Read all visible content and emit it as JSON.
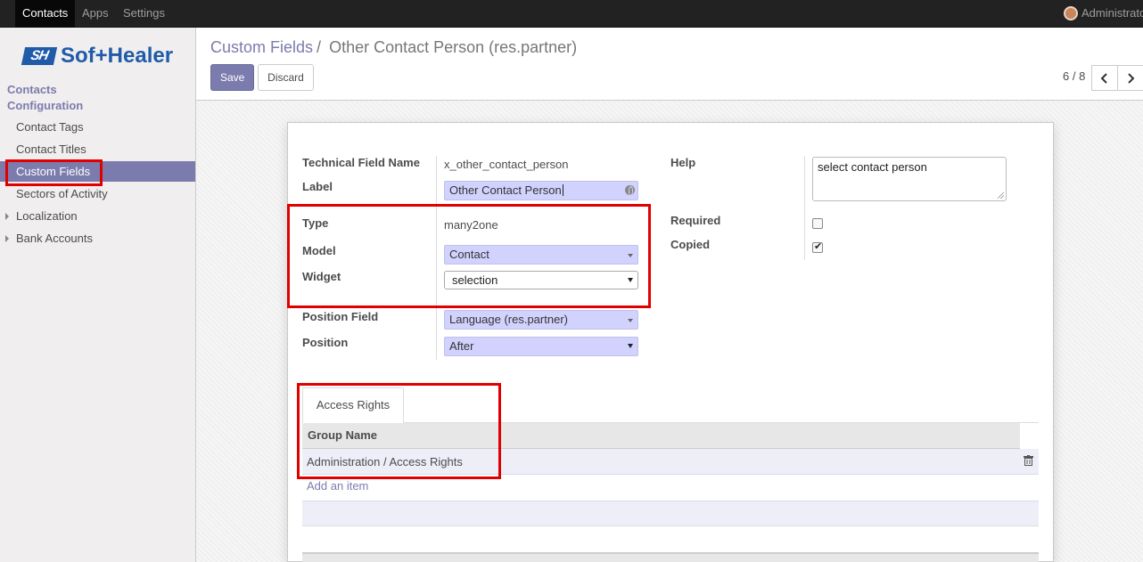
{
  "navbar": {
    "apps": [
      "Contacts",
      "Apps",
      "Settings"
    ],
    "user": "Administrator"
  },
  "sidebar": {
    "logo": {
      "mark": "SH",
      "word": "Sof+Healer"
    },
    "section": "Contacts",
    "subsection": "Configuration",
    "items": [
      {
        "label": "Contact Tags"
      },
      {
        "label": "Contact Titles"
      },
      {
        "label": "Custom Fields",
        "active": true
      },
      {
        "label": "Sectors of Activity"
      },
      {
        "label": "Localization",
        "expandable": true
      },
      {
        "label": "Bank Accounts",
        "expandable": true
      }
    ]
  },
  "control_panel": {
    "breadcrumb": {
      "parent": "Custom Fields",
      "separator": "/",
      "current": "Other Contact Person (res.partner)"
    },
    "save_label": "Save",
    "discard_label": "Discard",
    "pager": "6 / 8"
  },
  "form": {
    "left": {
      "technical_field_name": {
        "label": "Technical Field Name",
        "value": "x_other_contact_person"
      },
      "field_label": {
        "label": "Label",
        "value": "Other Contact Person"
      },
      "type": {
        "label": "Type",
        "value": "many2one"
      },
      "model": {
        "label": "Model",
        "value": "Contact"
      },
      "widget": {
        "label": "Widget",
        "value": "selection"
      },
      "position_field": {
        "label": "Position Field",
        "value": "Language (res.partner)"
      },
      "position": {
        "label": "Position",
        "value": "After"
      }
    },
    "right": {
      "help": {
        "label": "Help",
        "value": "select contact person"
      },
      "required": {
        "label": "Required",
        "checked": false
      },
      "copied": {
        "label": "Copied",
        "checked": true
      }
    }
  },
  "notebook": {
    "tab": "Access Rights",
    "column_header": "Group Name",
    "rows": [
      "Administration / Access Rights"
    ],
    "add_item": "Add an item"
  },
  "colors": {
    "brand": "#7c7bad",
    "highlight": "#e00000",
    "required_bg": "#d2d2ff"
  }
}
